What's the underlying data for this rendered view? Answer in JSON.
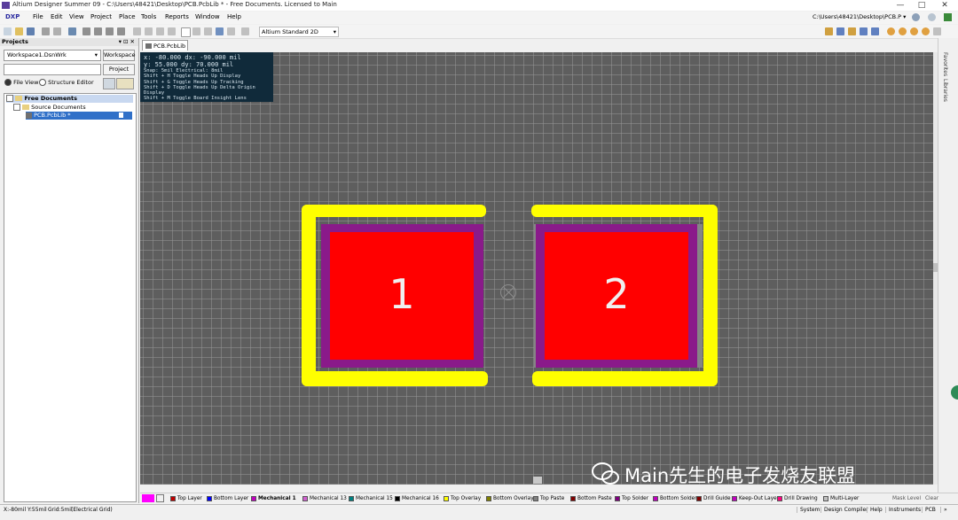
{
  "window": {
    "title": "Altium Designer Summer 09 - C:\\Users\\48421\\Desktop\\PCB.PcbLib * - Free Documents. Licensed to Main",
    "minimize": "—",
    "maximize": "□",
    "close": "✕"
  },
  "menu": {
    "items": [
      "DXP",
      "File",
      "Edit",
      "View",
      "Project",
      "Place",
      "Tools",
      "Reports",
      "Window",
      "Help"
    ],
    "path": "C:\\Users\\48421\\Desktop\\PCB.P ▾"
  },
  "toolbar": {
    "view_select": "Altium Standard 2D"
  },
  "panel": {
    "title": "Projects",
    "workspace_value": "Workspace1.DsnWrk",
    "workspace_button": "Workspace",
    "project_button": "Project",
    "file_view": "File View",
    "structure_editor": "Structure Editor",
    "tree": {
      "root": "Free Documents",
      "folder": "Source Documents",
      "file": "PCB.PcbLib *"
    }
  },
  "document": {
    "tab": "PCB.PcbLib *"
  },
  "hud": {
    "line1": "x:  -80.000  dx:  -90.000 mil",
    "line2": "y:   55.000  dy:   70.000 mil",
    "line3": "Snap: 5mil Electrical: 8mil",
    "line4": "Shift + H  Toggle Heads Up Display",
    "line5": "Shift + G  Toggle Heads Up Tracking",
    "line6": "Shift + D  Toggle Heads Up Delta Origin Display",
    "line7": "Shift + M  Toggle Board Insight Lens"
  },
  "pads": [
    {
      "label": "1"
    },
    {
      "label": "2"
    }
  ],
  "colors": {
    "canvas": "#5e5e5e",
    "pad": "#ff0000",
    "solder_mask": "#8a1a8a",
    "overlay": "#ffff00"
  },
  "layers": [
    {
      "name": "Top Layer",
      "color": "#c00000"
    },
    {
      "name": "Bottom Layer",
      "color": "#0000ff"
    },
    {
      "name": "Mechanical 1",
      "color": "#c000c0"
    },
    {
      "name": "Mechanical 13",
      "color": "#d060d0"
    },
    {
      "name": "Mechanical 15",
      "color": "#008080"
    },
    {
      "name": "Mechanical 16",
      "color": "#000000"
    },
    {
      "name": "Top Overlay",
      "color": "#ffff00"
    },
    {
      "name": "Bottom Overlay",
      "color": "#808000"
    },
    {
      "name": "Top Paste",
      "color": "#808080"
    },
    {
      "name": "Bottom Paste",
      "color": "#800000"
    },
    {
      "name": "Top Solder",
      "color": "#800080"
    },
    {
      "name": "Bottom Solder",
      "color": "#c000c0"
    },
    {
      "name": "Drill Guide",
      "color": "#800000"
    },
    {
      "name": "Keep-Out Layer",
      "color": "#c000c0"
    },
    {
      "name": "Drill Drawing",
      "color": "#ff0080"
    },
    {
      "name": "Multi-Layer",
      "color": "#c0c0c0"
    }
  ],
  "layerbar_right": {
    "mask_level": "Mask Level",
    "clear": "Clear"
  },
  "status": {
    "coords": "X:-80mil Y:55mil",
    "grid": "Grid:5mil",
    "electrical": "(Electrical Grid)",
    "right": [
      "System",
      "Design Compiler",
      "Help",
      "Instruments",
      "PCB",
      "»"
    ]
  },
  "sidebar_tabs": [
    "Favorites",
    "Libraries"
  ],
  "watermark": "Main先生的电子发烧友联盟"
}
